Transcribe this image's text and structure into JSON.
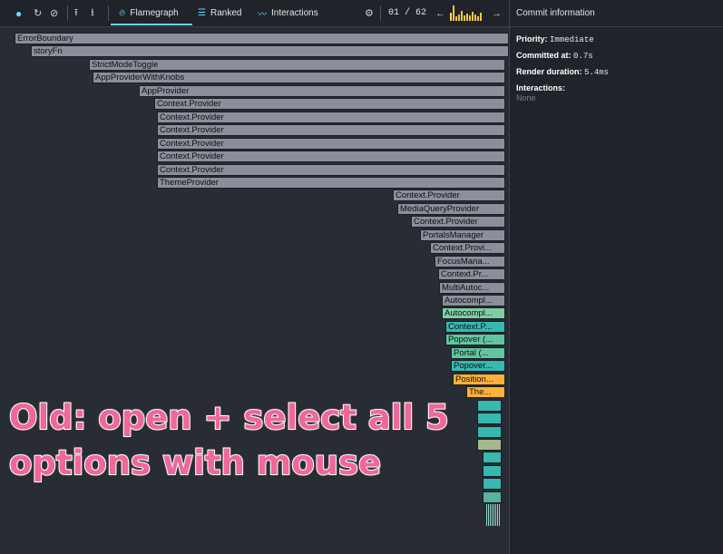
{
  "toolbar": {
    "record_icon": "record-dot-icon",
    "reload_icon": "reload-icon",
    "clear_icon": "clear-icon",
    "upload_icon": "upload-icon",
    "download_icon": "download-icon",
    "tabs": [
      {
        "label": "Flamegraph",
        "icon": "flame-icon",
        "active": true
      },
      {
        "label": "Ranked",
        "icon": "ranked-icon",
        "active": false
      },
      {
        "label": "Interactions",
        "icon": "interactions-icon",
        "active": false
      }
    ],
    "settings_icon": "gear-icon",
    "commit_counter": "01 / 62",
    "prev_icon": "arrow-left-icon",
    "next_icon": "arrow-right-icon",
    "commit_bar_levels": [
      0.45,
      0.85,
      0.25,
      0.35,
      0.55,
      0.3,
      0.4,
      0.28,
      0.5,
      0.35,
      0.25,
      0.45
    ]
  },
  "panel": {
    "title": "Commit information",
    "priority_label": "Priority",
    "priority_value": "Immediate",
    "committed_label": "Committed at",
    "committed_value": "0.7s",
    "render_label": "Render duration",
    "render_value": "5.4ms",
    "interactions_label": "Interactions",
    "interactions_value": "None"
  },
  "flamegraph": {
    "bars": [
      {
        "label": "ErrorBoundary",
        "color": "gray"
      },
      {
        "label": "storyFn",
        "color": "gray"
      },
      {
        "label": "StrictModeToggle",
        "color": "gray"
      },
      {
        "label": "AppProviderWithKnobs",
        "color": "gray"
      },
      {
        "label": "AppProvider",
        "color": "gray"
      },
      {
        "label": "Context.Provider",
        "color": "gray"
      },
      {
        "label": "Context.Provider",
        "color": "gray"
      },
      {
        "label": "Context.Provider",
        "color": "gray"
      },
      {
        "label": "Context.Provider",
        "color": "gray"
      },
      {
        "label": "Context.Provider",
        "color": "gray"
      },
      {
        "label": "Context.Provider",
        "color": "gray"
      },
      {
        "label": "ThemeProvider",
        "color": "gray"
      },
      {
        "label": "Context.Provider",
        "color": "gray"
      },
      {
        "label": "MediaQueryProvider",
        "color": "gray"
      },
      {
        "label": "Context.Provider",
        "color": "gray"
      },
      {
        "label": "PortalsManager",
        "color": "gray"
      },
      {
        "label": "Context.Provi...",
        "color": "gray"
      },
      {
        "label": "FocusMana...",
        "color": "gray"
      },
      {
        "label": "Context.Pr...",
        "color": "gray"
      },
      {
        "label": "MultiAutoc...",
        "color": "gray"
      },
      {
        "label": "Autocompl...",
        "color": "gray"
      },
      {
        "label": "Autocompl...",
        "color": "green2"
      },
      {
        "label": "Context.P...",
        "color": "teal"
      },
      {
        "label": "Popover (...",
        "color": "green"
      },
      {
        "label": "Portal (...",
        "color": "green"
      },
      {
        "label": "Popover...",
        "color": "teal"
      },
      {
        "label": "Position...",
        "color": "orange"
      },
      {
        "label": "The...",
        "color": "orange"
      }
    ]
  },
  "caption": {
    "line1": "Old: open + select all 5",
    "line2": "options with mouse"
  }
}
